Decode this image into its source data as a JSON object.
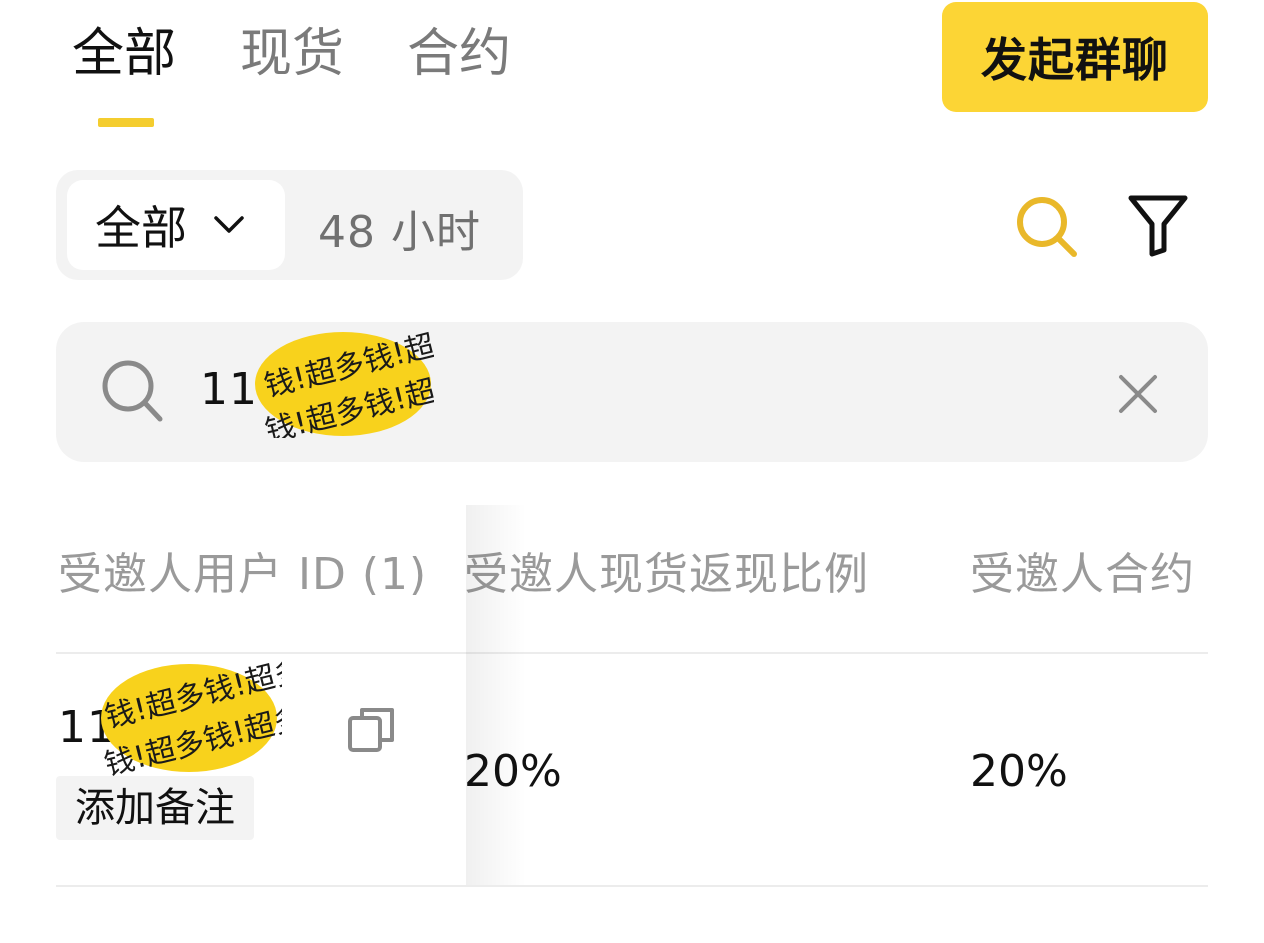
{
  "tabs": [
    {
      "label": "全部",
      "active": true
    },
    {
      "label": "现货",
      "active": false
    },
    {
      "label": "合约",
      "active": false
    }
  ],
  "header": {
    "group_chat_label": "发起群聊"
  },
  "filter": {
    "selected": "全部",
    "other": "48 小时"
  },
  "icons": {
    "search_toggle": "search-icon",
    "filter_toggle": "filter-icon",
    "search_field": "search-icon",
    "clear": "close-icon",
    "copy": "copy-icon",
    "dropdown": "chevron-down-icon"
  },
  "search": {
    "value": "119 89"
  },
  "watermark_text": "钱!超多钱!超多钱!",
  "table": {
    "headers": [
      "受邀人用户 ID (1)",
      "受邀人现货返现比例",
      "受邀人合约"
    ],
    "rows": [
      {
        "user_id": "11 89",
        "add_note_label": "添加备注",
        "spot_rate": "20%",
        "futures_rate": "20%"
      }
    ]
  },
  "colors": {
    "accent": "#fcd535",
    "underline": "#f4cd2f",
    "text": "#111111",
    "muted": "#9a9a9a",
    "surface": "#f3f3f3"
  }
}
